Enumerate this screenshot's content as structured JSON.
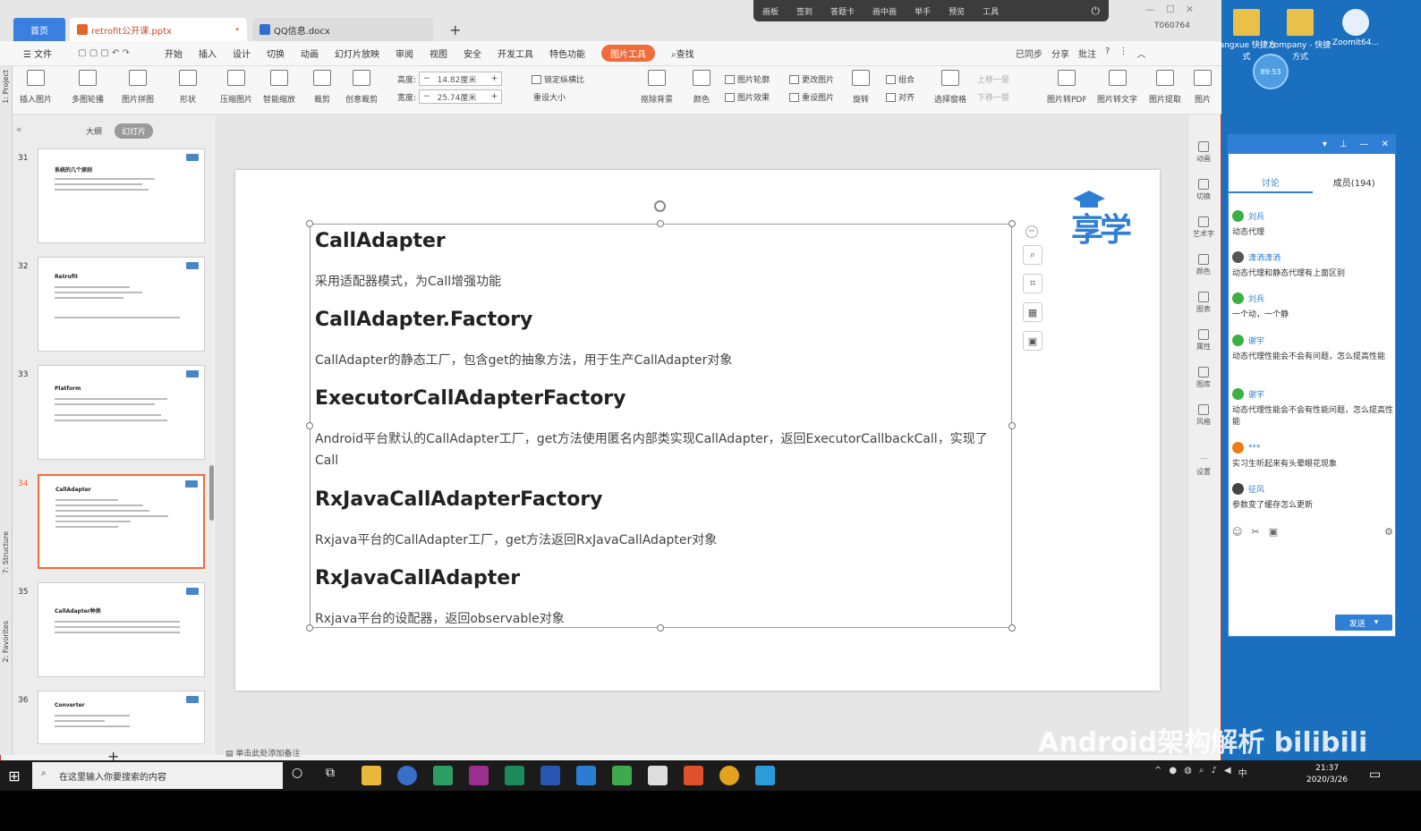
{
  "tabs": {
    "home": "首页",
    "pptx": "retrofit公开课.pptx",
    "docx": "QQ信息.docx",
    "add": "+"
  },
  "overlay": [
    "画板",
    "签到",
    "答题卡",
    "画中画",
    "举手",
    "预览",
    "工具"
  ],
  "user_id": "T060764",
  "menu": [
    "文件",
    "开始",
    "插入",
    "设计",
    "切换",
    "动画",
    "幻灯片放映",
    "审阅",
    "视图",
    "安全",
    "开发工具",
    "特色功能",
    "图片工具",
    "查找"
  ],
  "menu_active": "图片工具",
  "menu_right": [
    "已同步",
    "分享",
    "批注"
  ],
  "ribbon": {
    "insert_pic": "插入图片",
    "multi_outline": "多图轮播",
    "pic_collage": "图片拼图",
    "shape": "形状",
    "compress": "压缩图片",
    "smart_scale": "智能缩放",
    "crop": "裁剪",
    "creative_crop": "创意裁剪",
    "height_label": "高度:",
    "height_val": "14.82厘米",
    "width_label": "宽度:",
    "width_val": "25.74厘米",
    "lock_ratio": "锁定纵横比",
    "reset_size": "重设大小",
    "remove_bg": "抠除背景",
    "color": "颜色",
    "pic_outline": "图片轮廓",
    "pic_effect": "图片效果",
    "change_pic": "更改图片",
    "reset_pic": "重设图片",
    "rotate": "旋转",
    "group": "组合",
    "align": "对齐",
    "select_pane": "选择窗格",
    "up": "上移一层",
    "down": "下移一层",
    "to_pdf": "图片转PDF",
    "to_text": "图片转文字",
    "extract": "图片提取",
    "more": "图片"
  },
  "panel_tabs": {
    "outline": "大纲",
    "slides": "幻灯片"
  },
  "left_labels": {
    "project": "1: Project",
    "structure": "7: Structure",
    "favorites": "2: Favorites"
  },
  "slides": [
    {
      "num": "31",
      "title": "系统的几个原则"
    },
    {
      "num": "32",
      "title": "Retrofit"
    },
    {
      "num": "33",
      "title": "Platform"
    },
    {
      "num": "34",
      "title": "CallAdapter"
    },
    {
      "num": "35",
      "title": "CallAdapter种类"
    },
    {
      "num": "36",
      "title": "Converter"
    }
  ],
  "content": {
    "h1": "CallAdapter",
    "p1": "采用适配器模式，为Call增强功能",
    "h2": "CallAdapter.Factory",
    "p2": "CallAdapter的静态工厂，包含get的抽象方法，用于生产CallAdapter对象",
    "h3": "ExecutorCallAdapterFactory",
    "p3": "Android平台默认的CallAdapter工厂，get方法使用匿名内部类实现CallAdapter，返回ExecutorCallbackCall，实现了Call",
    "h4": "RxJavaCallAdapterFactory",
    "p4": "Rxjava平台的CallAdapter工厂，get方法返回RxJavaCallAdapter对象",
    "h5": "RxJavaCallAdapter",
    "p5": "Rxjava平台的设配器，返回observable对象"
  },
  "logo_text": "享学",
  "right_tools": [
    "动画",
    "切换",
    "艺术字",
    "颜色",
    "图表",
    "属性",
    "图库",
    "风格",
    "设置"
  ],
  "notes": "单击此处添加备注",
  "desktop_icons": [
    "iangxue 快捷方式",
    "company - 快捷方式",
    "ZoomIt64..."
  ],
  "timer": "89:53",
  "chat": {
    "tabs": [
      "讨论",
      "成员(194)"
    ],
    "messages": [
      {
        "user": "刘兵",
        "text": "动态代理"
      },
      {
        "user": "潇洒潇洒",
        "text": "动态代理和静态代理有上面区别"
      },
      {
        "user": "刘兵",
        "text": "一个动，一个静"
      },
      {
        "user": "谢宇",
        "text": "动态代理性能会不会有问题，怎么提高性能"
      },
      {
        "user": "谢宇",
        "text": "动态代理性能会不会有性能问题，怎么提高性能"
      },
      {
        "user": "***",
        "text": "实习生听起来有头晕眼花现象"
      },
      {
        "user": "征风",
        "text": "参数变了缓存怎么更新"
      }
    ],
    "send": "发送"
  },
  "watermark": "Android架构解析 bilibili",
  "taskbar": {
    "search": "在这里输入你要搜索的内容",
    "time": "21:37",
    "date": "2020/3/26",
    "ime": "中"
  },
  "colors": {
    "accent": "#f26b3a",
    "blue": "#2f7fd6"
  }
}
